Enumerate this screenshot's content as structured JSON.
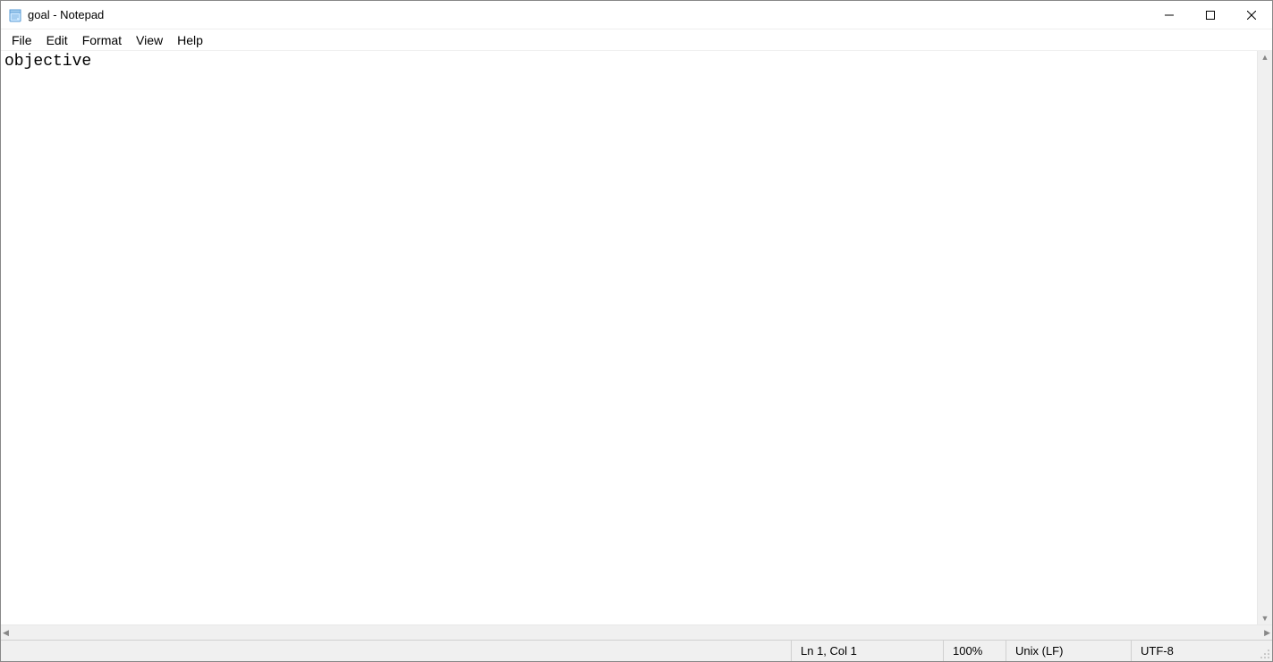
{
  "titlebar": {
    "title": "goal - Notepad"
  },
  "menu": {
    "items": [
      "File",
      "Edit",
      "Format",
      "View",
      "Help"
    ]
  },
  "editor": {
    "content": "objective"
  },
  "statusbar": {
    "position": "Ln 1, Col 1",
    "zoom": "100%",
    "line_ending": "Unix (LF)",
    "encoding": "UTF-8"
  }
}
